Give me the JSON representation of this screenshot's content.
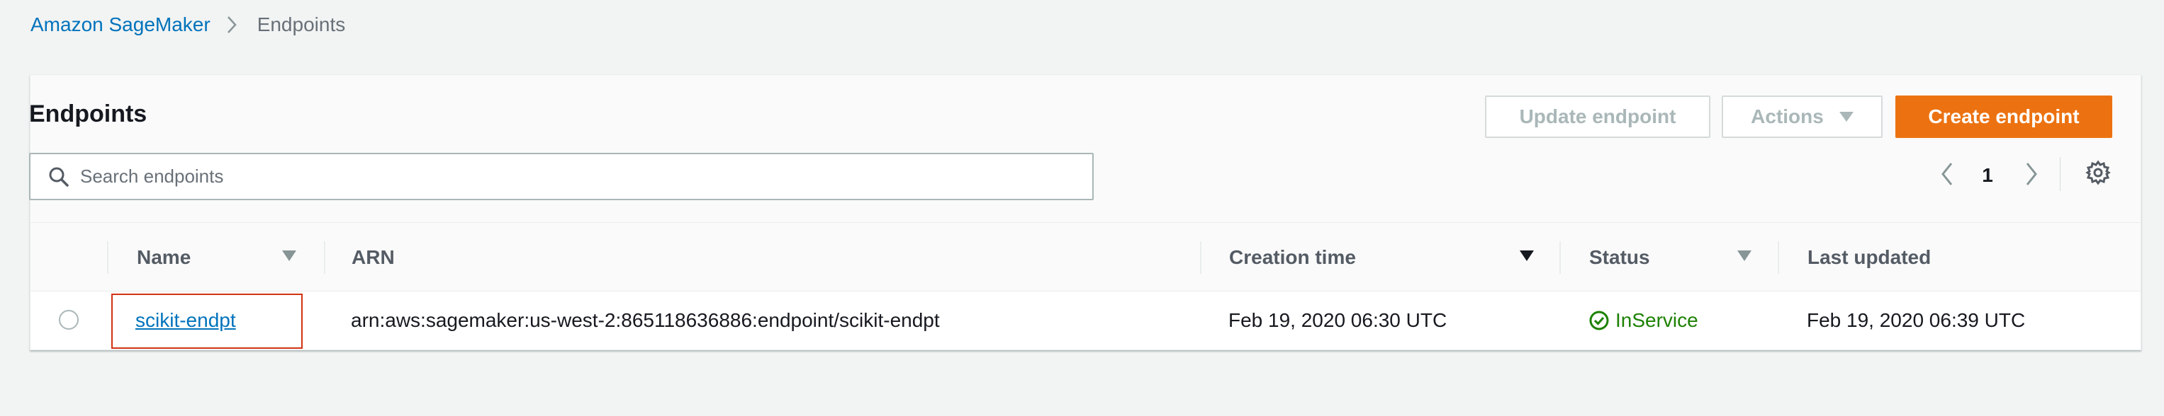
{
  "breadcrumb": {
    "root": "Amazon SageMaker",
    "current": "Endpoints"
  },
  "panel": {
    "title": "Endpoints",
    "buttons": {
      "update": "Update endpoint",
      "actions": "Actions",
      "create": "Create endpoint"
    },
    "search": {
      "placeholder": "Search endpoints",
      "value": ""
    },
    "pagination": {
      "page": "1"
    }
  },
  "table": {
    "headers": {
      "name": "Name",
      "arn": "ARN",
      "creation_time": "Creation time",
      "status": "Status",
      "last_updated": "Last updated"
    },
    "rows": [
      {
        "name": "scikit-endpt",
        "arn": "arn:aws:sagemaker:us-west-2:865118636886:endpoint/scikit-endpt",
        "creation_time": "Feb 19, 2020 06:30 UTC",
        "status": "InService",
        "last_updated": "Feb 19, 2020 06:39 UTC"
      }
    ]
  },
  "colors": {
    "link": "#0073bb",
    "primary": "#ec7211",
    "status_ok": "#1d8102",
    "highlight": "#d13212"
  },
  "icons": [
    "chevron-right-icon",
    "search-icon",
    "caret-down-icon",
    "chevron-left-icon",
    "gear-icon",
    "check-circle-icon"
  ]
}
